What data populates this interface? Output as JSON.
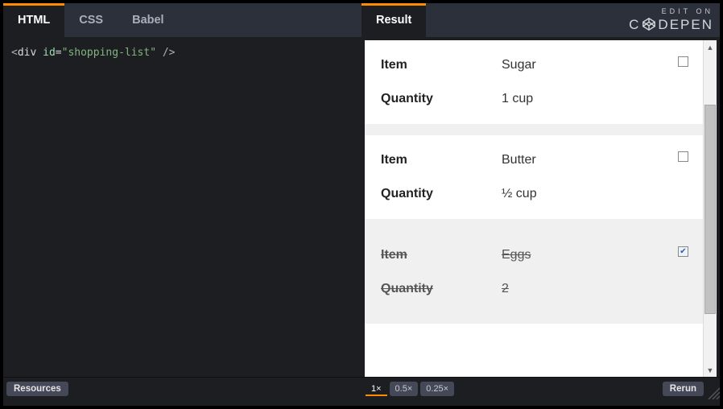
{
  "tabs": {
    "html": "HTML",
    "css": "CSS",
    "babel": "Babel",
    "result": "Result"
  },
  "badge": {
    "edit_on": "EDIT ON",
    "brand": "CODEPEN"
  },
  "code": {
    "tag_open": "<",
    "tag_name": "div",
    "attr_name": "id",
    "attr_value": "\"shopping-list\"",
    "tag_close": " />"
  },
  "labels": {
    "item": "Item",
    "quantity": "Quantity"
  },
  "items": [
    {
      "name": "Sugar",
      "qty": "1 cup",
      "done": false
    },
    {
      "name": "Butter",
      "qty": "½ cup",
      "done": false
    },
    {
      "name": "Eggs",
      "qty": "2",
      "done": true
    }
  ],
  "footer": {
    "resources": "Resources",
    "rerun": "Rerun",
    "z1": "1×",
    "z05": "0.5×",
    "z025": "0.25×"
  }
}
